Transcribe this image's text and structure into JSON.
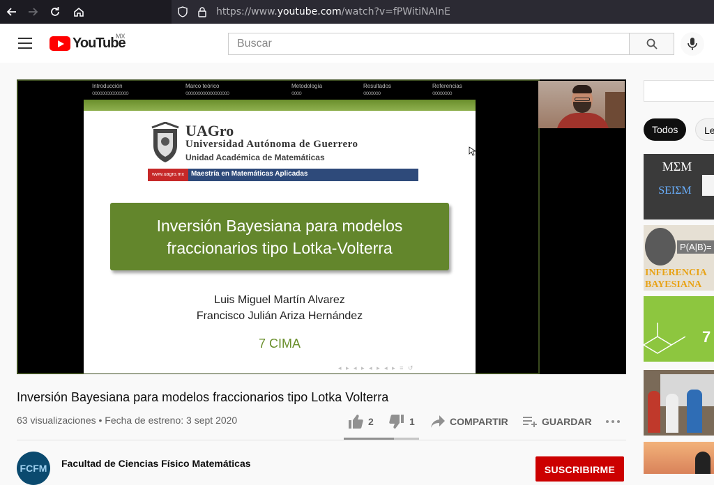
{
  "browser": {
    "url_prefix": "https://www.",
    "url_domain": "youtube.com",
    "url_rest": "/watch?v=fPWitiNAInE"
  },
  "header": {
    "logo_text": "YouTube",
    "country_code": "MX",
    "search_placeholder": "Buscar"
  },
  "slide": {
    "nav": [
      "Introducción",
      "Marco teórico",
      "Metodología",
      "Resultados",
      "Referencias"
    ],
    "nav_dots": [
      "ooooooooooooooo",
      "oooooooooooooooooo",
      "oooo",
      "ooooooo",
      "oooooooo"
    ],
    "org_short": "UAGro",
    "org_name": "Universidad Autónoma de Guerrero",
    "org_unit": "Unidad Académica de Matemáticas",
    "org_site": "www.uagro.mx",
    "program": "Maestría en Matemáticas Aplicadas",
    "title_line1": "Inversión Bayesiana para modelos",
    "title_line2": "fraccionarios tipo Lotka-Volterra",
    "author1": "Luis Miguel Martín Alvarez",
    "author2": "Francisco Julián Ariza Hernández",
    "event": "7 CIMA"
  },
  "video": {
    "title": "Inversión Bayesiana para modelos fraccionarios tipo Lotka Volterra",
    "meta": "63 visualizaciones • Fecha de estreno: 3 sept 2020",
    "likes": "2",
    "dislikes": "1",
    "share_label": "COMPARTIR",
    "save_label": "GUARDAR",
    "like_ratio": 0.67
  },
  "channel": {
    "avatar_text": "FCFM",
    "name": "Facultad de Ciencias Físico Matemáticas",
    "subscribe_label": "SUSCRIBIRME"
  },
  "sidebar": {
    "chips": [
      "Todos",
      "Le"
    ],
    "thumb1_lines": [
      "MΣM",
      "SEIΣM"
    ],
    "thumb2_text": "P(A|B)=",
    "thumb2_caption": [
      "INFERENCIA",
      "BAYESIANA"
    ],
    "thumb3_text": "7"
  },
  "colors": {
    "youtube_red": "#ff0000",
    "subscribe_red": "#cc0000",
    "slide_green": "#63862c"
  }
}
